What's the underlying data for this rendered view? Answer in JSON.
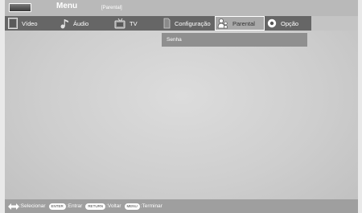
{
  "header": {
    "title": "Menu",
    "subtitle": "[Parental]"
  },
  "tabs": [
    {
      "label": "Vídeo",
      "icon": "video-icon"
    },
    {
      "label": "Áudio",
      "icon": "audio-icon"
    },
    {
      "label": "TV",
      "icon": "tv-icon"
    },
    {
      "label": "Configuração",
      "icon": "settings-icon"
    },
    {
      "label": "Parental",
      "icon": "parental-icon",
      "active": true
    },
    {
      "label": "Opção",
      "icon": "option-icon"
    }
  ],
  "submenu": {
    "items": [
      {
        "label": "Senha"
      }
    ]
  },
  "footer": {
    "select_label": ":Selecionar",
    "enter_key": "ENTER",
    "enter_label": ":Entrar",
    "return_key": "RETURN",
    "return_label": ":Voltar",
    "menu_key": "MENU",
    "menu_label": ":Terminar"
  },
  "colors": {
    "tabbar": "#666666",
    "active_tab": "#a9a9a9",
    "submenu_item": "#8f8f8f",
    "footer": "#9f9f9f"
  }
}
